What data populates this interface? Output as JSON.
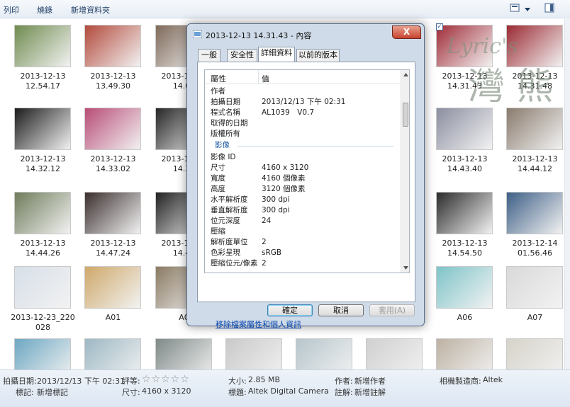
{
  "toolbar": {
    "print": "列印",
    "burn": "燒錄",
    "new_folder": "新增資料夾"
  },
  "thumbnails": [
    {
      "line1": "2013-12-13",
      "line2": "12.54.17",
      "color": "#6f8b4f"
    },
    {
      "line1": "2013-12-13",
      "line2": "13.49.30",
      "color": "#b34a3c"
    },
    {
      "line1": "2013-12-13",
      "line2": "14.06",
      "color": "#7f6a5a"
    },
    {
      "line1": "2013-12-13",
      "line2": "14.31.43",
      "color": "#a02b37"
    },
    {
      "line1": "2013-12-13",
      "line2": "14.31.48",
      "color": "#9b2a33"
    },
    {
      "line1": "2013-12-13",
      "line2": "14.32.12",
      "color": "#1c1c1c"
    },
    {
      "line1": "2013-12-13",
      "line2": "14.33.02",
      "color": "#b84d77"
    },
    {
      "line1": "2013-12-13",
      "line2": "14.33",
      "color": "#262626"
    },
    {
      "line1": "2013-12-13",
      "line2": "14.43.40",
      "color": "#8b8ea0"
    },
    {
      "line1": "2013-12-13",
      "line2": "14.44.12",
      "color": "#8a7b6e"
    },
    {
      "line1": "2013-12-13",
      "line2": "14.44.26",
      "color": "#6f7c5b"
    },
    {
      "line1": "2013-12-13",
      "line2": "14.47.24",
      "color": "#3b2f2f"
    },
    {
      "line1": "2013-12-13",
      "line2": "14.48",
      "color": "#222"
    },
    {
      "line1": "2013-12-13",
      "line2": "14.54.50",
      "color": "#2b2b2b"
    },
    {
      "line1": "2013-12-14",
      "line2": "01.56.46",
      "color": "#3e5f86"
    },
    {
      "line1": "2013-12-23_220",
      "line2": "028",
      "color": "#d7dfe8"
    },
    {
      "line1": "A01",
      "line2": "",
      "color": "#cfa86a"
    },
    {
      "line1": "A0",
      "line2": "",
      "color": "#8a7a62"
    },
    {
      "line1": "A06",
      "line2": "",
      "color": "#7ec4c9"
    },
    {
      "line1": "A07",
      "line2": "",
      "color": "#d9d9d9"
    },
    {
      "line1": "",
      "line2": "",
      "color": "#6da7c2"
    },
    {
      "line1": "",
      "line2": "",
      "color": "#9db8c4"
    },
    {
      "line1": "",
      "line2": "",
      "color": "#7f8a88"
    },
    {
      "line1": "",
      "line2": "",
      "color": "#c9c9c9"
    },
    {
      "line1": "",
      "line2": "",
      "color": "#b7c6cc"
    },
    {
      "line1": "",
      "line2": "",
      "color": "#d0d0d0"
    },
    {
      "line1": "",
      "line2": "",
      "color": "#bdb2a3"
    },
    {
      "line1": "",
      "line2": "",
      "color": "#d6d3c9"
    }
  ],
  "watermark": {
    "text": "Lyric's",
    "chars": "灣 熊"
  },
  "dialog": {
    "title": "2013-12-13 14.31.43 - 內容",
    "close": "X",
    "tabs": [
      "一般",
      "安全性",
      "詳細資料",
      "以前的版本"
    ],
    "active_tab": 2,
    "col_property": "屬性",
    "col_value": "值",
    "rows": [
      {
        "k": "作者",
        "v": ""
      },
      {
        "k": "拍攝日期",
        "v": "2013/12/13 下午 02:31"
      },
      {
        "k": "程式名稱",
        "v": "AL1039　V0.7"
      },
      {
        "k": "取得的日期",
        "v": ""
      },
      {
        "k": "版權所有",
        "v": ""
      }
    ],
    "section": "影像",
    "rows2": [
      {
        "k": "影像 ID",
        "v": ""
      },
      {
        "k": "尺寸",
        "v": "4160 x 3120"
      },
      {
        "k": "寬度",
        "v": "4160 個像素"
      },
      {
        "k": "高度",
        "v": "3120 個像素"
      },
      {
        "k": "水平解析度",
        "v": "300 dpi"
      },
      {
        "k": "垂直解析度",
        "v": "300 dpi"
      },
      {
        "k": "位元深度",
        "v": "24"
      },
      {
        "k": "壓縮",
        "v": ""
      },
      {
        "k": "解析度單位",
        "v": "2"
      },
      {
        "k": "色彩呈現",
        "v": "sRGB"
      },
      {
        "k": "壓縮位元/像素",
        "v": "2"
      }
    ],
    "remove_link": "移除檔案屬性和個人資訊",
    "ok": "確定",
    "cancel": "取消",
    "apply": "套用(A)"
  },
  "status": {
    "date_label": "拍攝日期:",
    "date_value": "2013/12/13 下午 02:31",
    "rating_label": "評等:",
    "stars": "☆☆☆☆☆",
    "size_label": "大小:",
    "size_value": "2.85 MB",
    "author_label": "作者:",
    "author_value": "新增作者",
    "maker_label": "相機製造商:",
    "maker_value": "Altek",
    "tags_label": "標記:",
    "tags_value": "新增標記",
    "dims_label": "尺寸:",
    "dims_value": "4160 x 3120",
    "title_label": "標題:",
    "title_value": "Altek Digital Camera",
    "comment_label": "註解:",
    "comment_value": "新增註解"
  }
}
